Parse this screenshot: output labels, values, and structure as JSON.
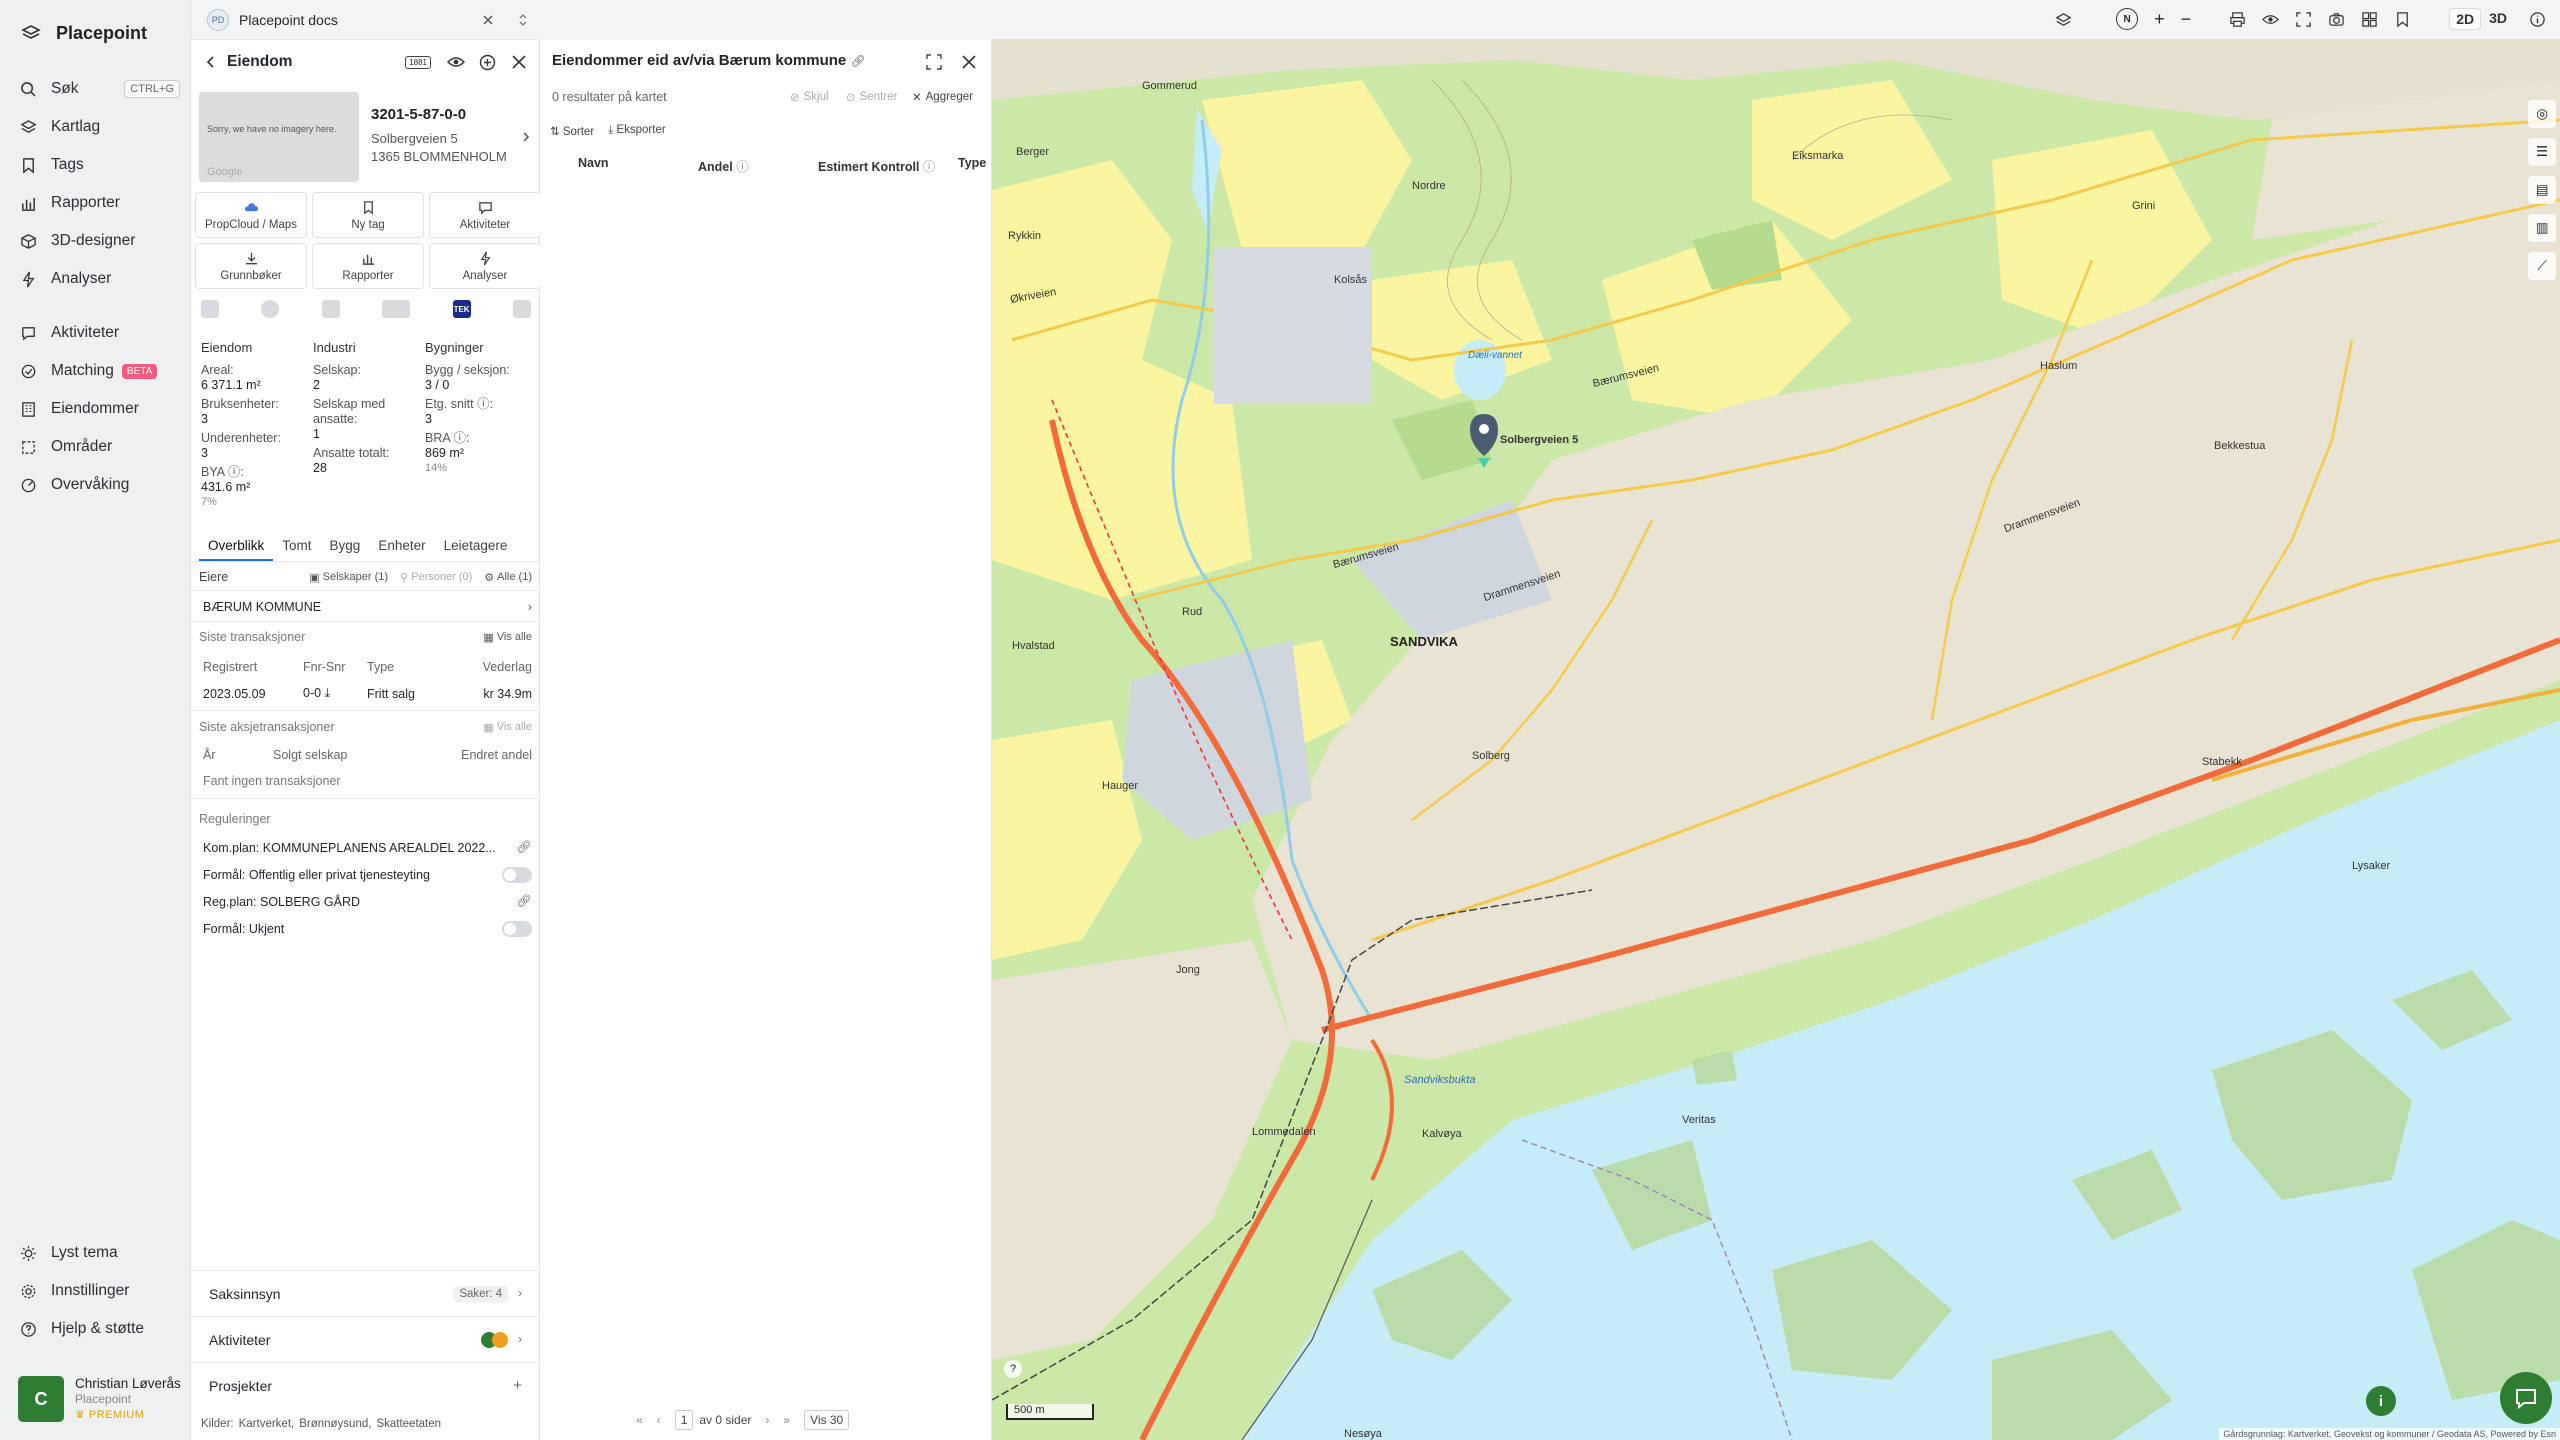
{
  "brand": {
    "name": "Placepoint"
  },
  "nav": {
    "items": [
      {
        "label": "Søk",
        "shortcut": "CTRL+G"
      },
      {
        "label": "Kartlag"
      },
      {
        "label": "Tags"
      },
      {
        "label": "Rapporter"
      },
      {
        "label": "3D-designer"
      },
      {
        "label": "Analyser"
      },
      {
        "label": "Aktiviteter"
      },
      {
        "label": "Matching",
        "badge": "BETA"
      },
      {
        "label": "Eiendommer"
      },
      {
        "label": "Områder"
      },
      {
        "label": "Overvåking"
      }
    ],
    "bottom": [
      {
        "label": "Lyst tema"
      },
      {
        "label": "Innstillinger"
      },
      {
        "label": "Hjelp & støtte"
      }
    ],
    "user": {
      "initial": "C",
      "name": "Christian Løverås",
      "company": "Placepoint",
      "plan": "PREMIUM"
    }
  },
  "docs_tab": {
    "badge": "PD",
    "title": "Placepoint docs"
  },
  "property": {
    "header": "Eiendom",
    "header_badge": "1881",
    "thumbnail_text": "Sorry, we have no imagery here.",
    "thumbnail_google": "Google",
    "id": "3201-5-87-0-0",
    "address1": "Solbergveien 5",
    "address2": "1365 BLOMMENHOLM",
    "tiles": [
      "PropCloud / Maps",
      "Ny tag",
      "Aktiviteter",
      "Grunnbøker",
      "Rapporter",
      "Analyser"
    ],
    "src_tek": "TEK",
    "stats": {
      "col1_head": "Eiendom",
      "areal_label": "Areal:",
      "areal_value": "6 371.1 m²",
      "bruks_label": "Bruksenheter:",
      "bruks_value": "3",
      "under_label": "Underenheter:",
      "under_value": "3",
      "bya_label": "BYA ⓘ:",
      "bya_value": "431.6 m²",
      "bya_pct": "7%",
      "col2_head": "Industri",
      "selskap_label": "Selskap:",
      "selskap_value": "2",
      "ansatte_label": "Selskap med ansatte:",
      "ansatte_value": "1",
      "ansatte_totalt_label": "Ansatte totalt:",
      "ansatte_totalt_value": "28",
      "col3_head": "Bygninger",
      "bygg_label": "Bygg / seksjon:",
      "bygg_value": "3 / 0",
      "etg_label": "Etg. snitt ⓘ:",
      "etg_value": "3",
      "bra_label": "BRA ⓘ:",
      "bra_value": "869 m²",
      "bra_pct": "14%"
    },
    "tabs": [
      "Overblikk",
      "Tomt",
      "Bygg",
      "Enheter",
      "Leietagere"
    ],
    "eiere_label": "Eiere",
    "chip_selskaper": "Selskaper (1)",
    "chip_personer": "Personer (0)",
    "chip_alle": "Alle (1)",
    "owner": "BÆRUM KOMMUNE",
    "trans_label": "Siste transaksjoner",
    "vis_alle": "Vis alle",
    "trans_headers": [
      "Registrert",
      "Fnr-Snr",
      "Type",
      "Vederlag"
    ],
    "trans_row": {
      "date": "2023.05.09",
      "fnr": "0-0",
      "type": "Fritt salg",
      "amount": "kr 34.9m"
    },
    "aksje_label": "Siste aksjetransaksjoner",
    "aksje_vis_alle": "Vis alle",
    "aksje_headers": [
      "År",
      "Solgt selskap",
      "Endret andel"
    ],
    "aksje_empty": "Fant ingen transaksjoner",
    "reg_label": "Reguleringer",
    "reg_items": [
      "Kom.plan: KOMMUNEPLANENS AREALDEL 2022...",
      "Formål: Offentlig eller privat tjenesteyting",
      "Reg.plan: SOLBERG GÅRD",
      "Formål: Ukjent"
    ],
    "saksinnsyn": "Saksinnsyn",
    "saker": "Saker: 4",
    "aktiviteter": "Aktiviteter",
    "prosjekter": "Prosjekter",
    "sources_label": "Kilder:",
    "sources": [
      "Kartverket,",
      "Brønnøysund,",
      "Skatteetaten"
    ]
  },
  "results": {
    "title": "Eiendommer eid av/via Bærum kommune",
    "count_text": "0 resultater på kartet",
    "actions": [
      "Skjul",
      "Sentrer",
      "Aggreger"
    ],
    "sort": "Sorter",
    "export": "Eksporter",
    "columns": [
      "Navn",
      "Andel",
      "Estimert Kontroll",
      "Type"
    ],
    "pager_of": "av 0 sider",
    "pager_page": "1",
    "pager_show": "Vis 30"
  },
  "map": {
    "scale": "500 m",
    "attribution": "Gårdsgrunnlag: Kartverket, Geovekst og kommuner / Geodata AS, Powered by Esri",
    "marker_label": "Solbergveien 5",
    "labels": {
      "sandvika": "SANDVIKA",
      "baerumsveien": "Bærumsveien",
      "drammensveien": "Drammensveien",
      "okriveien": "Økriveien",
      "kolsas": "Kolsås",
      "haslum": "Haslum",
      "solberg": "Solberg",
      "jar": "Nordre",
      "dael": "Dæli-vannet",
      "gommerud": "Gommerud",
      "berger": "Berger",
      "rykkin": "Rykkin",
      "hvalstad": "Hauger",
      "jong": "Jong",
      "rud": "Rud",
      "sandviksbukta": "Sandviksbukta",
      "kalvoya": "Kalvøya",
      "veritas": "Veritas",
      "nesoya": "Nesøya",
      "holmen": "Hvalstad",
      "stabekk": "Stabekk",
      "bekkestua": "Bekkestua",
      "lysaker": "Lysaker",
      "grini": "Grini",
      "eiksmarka": "Eiksmarka",
      "lommedalen": "Lommedalen"
    },
    "controls": {
      "mode_2d": "2D",
      "mode_3d": "3D",
      "north": "N"
    }
  },
  "colors": {
    "accent": "#1a73e8",
    "brand_green": "#2e7d32",
    "map_green": "#cbe8a9",
    "water": "#c6ecf7",
    "road_orange": "#f26b3a"
  }
}
